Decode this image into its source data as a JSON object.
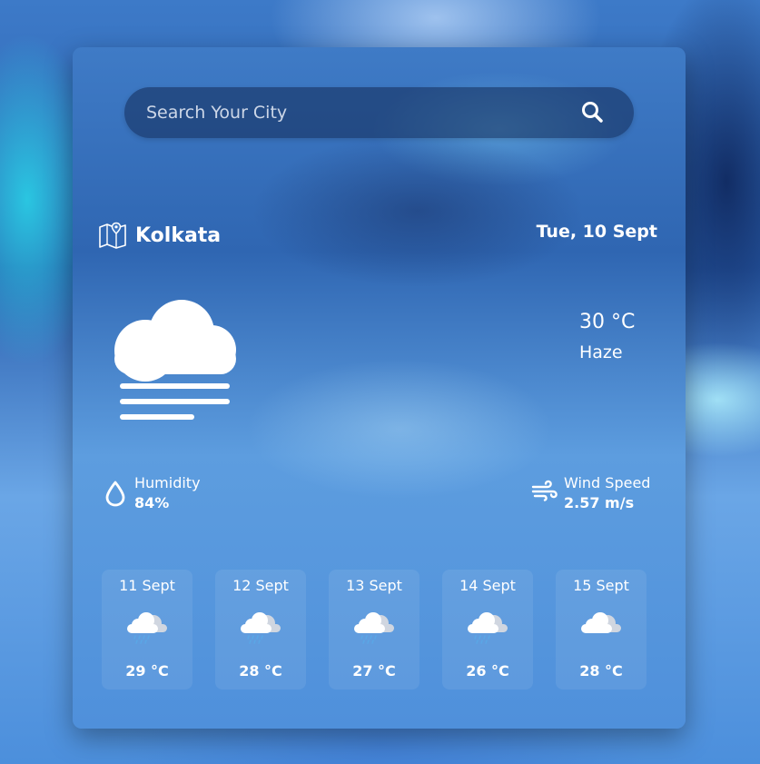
{
  "search": {
    "placeholder": "Search Your City",
    "value": "",
    "icon": "search-icon"
  },
  "location": {
    "city": "Kolkata",
    "icon": "map-pin-icon"
  },
  "date": "Tue, 10 Sept",
  "current": {
    "temperature": "30 °C",
    "condition": "Haze",
    "icon": "haze-cloud-icon"
  },
  "humidity": {
    "label": "Humidity",
    "value": "84%",
    "icon": "water-drop-icon"
  },
  "wind": {
    "label": "Wind Speed",
    "value": "2.57 m/s",
    "icon": "wind-icon"
  },
  "forecast": [
    {
      "date": "11 Sept",
      "temp": "29 °C",
      "icon": "rain-cloud-icon"
    },
    {
      "date": "12 Sept",
      "temp": "28 °C",
      "icon": "rain-cloud-icon"
    },
    {
      "date": "13 Sept",
      "temp": "27 °C",
      "icon": "rain-cloud-icon"
    },
    {
      "date": "14 Sept",
      "temp": "26 °C",
      "icon": "rain-cloud-icon"
    },
    {
      "date": "15 Sept",
      "temp": "28 °C",
      "icon": "cloud-icon"
    }
  ]
}
